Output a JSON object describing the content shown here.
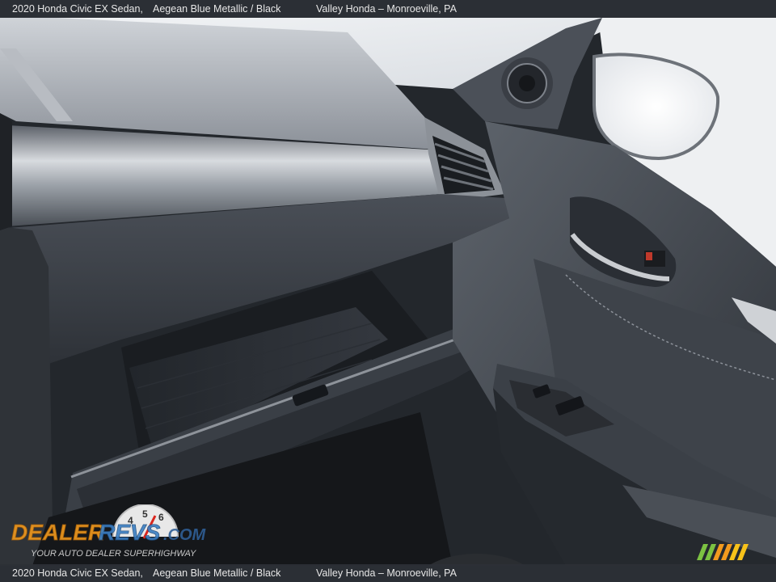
{
  "caption": {
    "vehicle": "2020 Honda Civic EX Sedan,",
    "colors": "Aegean Blue Metallic / Black",
    "dealer": "Valley Honda – Monroeville, PA"
  },
  "watermark": {
    "brand": "DealerRevs.com",
    "tagline": "Your Auto Dealer SuperHighway",
    "speedometer_digits": [
      "4",
      "5",
      "6"
    ]
  },
  "colors": {
    "caption_bar": "#2d3036",
    "caption_text": "#e7e7e7",
    "dash_dark": "#2a2e34",
    "dash_mid": "#3c4148",
    "trim_silver": "#c9ccd0",
    "logo_orange": "#f29a1e",
    "logo_blue": "#3b7fc4"
  }
}
